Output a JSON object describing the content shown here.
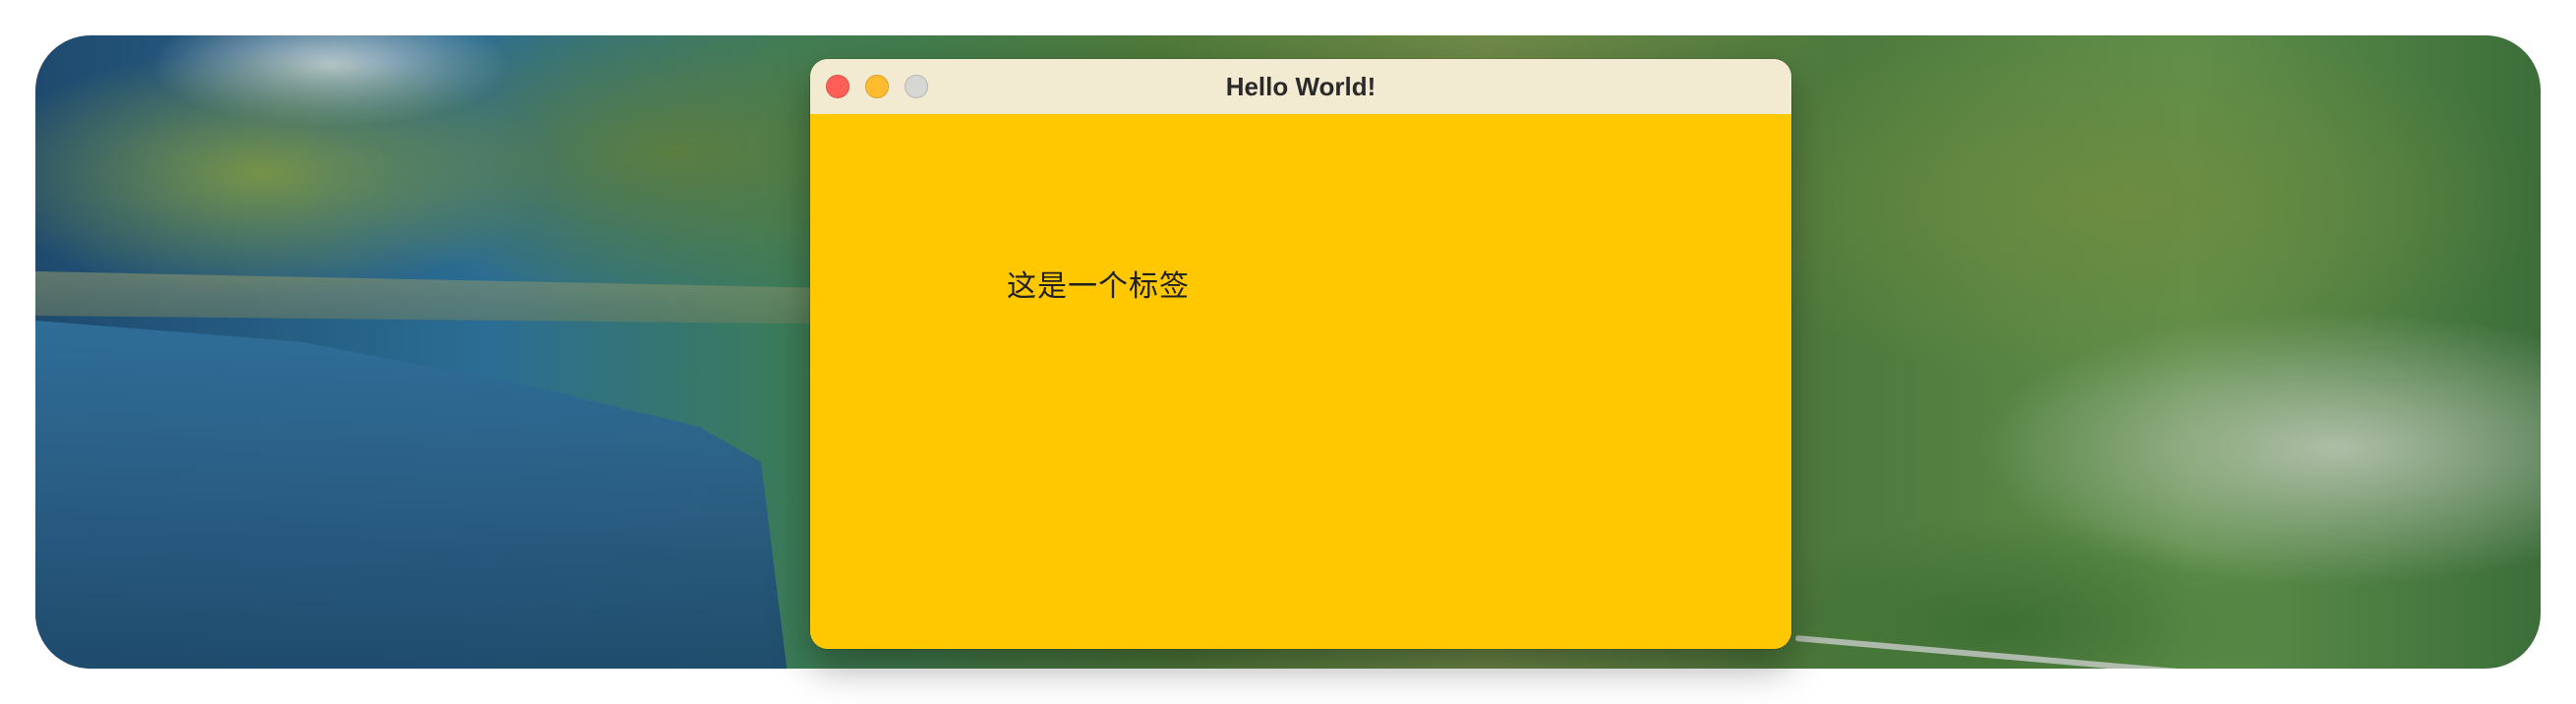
{
  "window": {
    "title": "Hello World!",
    "traffic_lights": {
      "close_color": "#ff5f57",
      "minimize_color": "#febc2e",
      "zoom_color": "#d6d6d2"
    }
  },
  "content": {
    "label": "这是一个标签",
    "background_color": "#ffc800"
  }
}
